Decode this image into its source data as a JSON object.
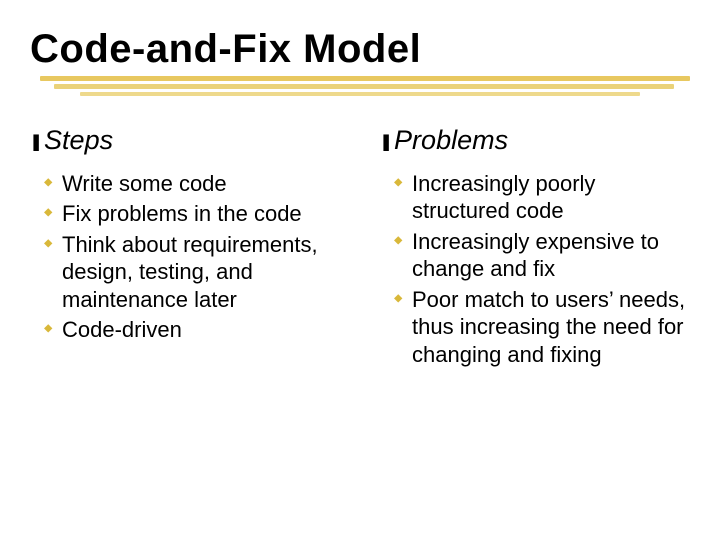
{
  "title": "Code-and-Fix Model",
  "bullets": {
    "z_glyph": "❚",
    "y_glyph": "◆"
  },
  "left": {
    "heading": "Steps",
    "items": [
      "Write some code",
      "Fix problems in the code",
      "Think about requirements, design, testing, and maintenance later",
      "Code-driven"
    ]
  },
  "right": {
    "heading": "Problems",
    "items": [
      "Increasingly poorly structured code",
      "Increasingly expensive to change and fix",
      "Poor match to users’ needs, thus increasing the need for changing and fixing"
    ]
  }
}
